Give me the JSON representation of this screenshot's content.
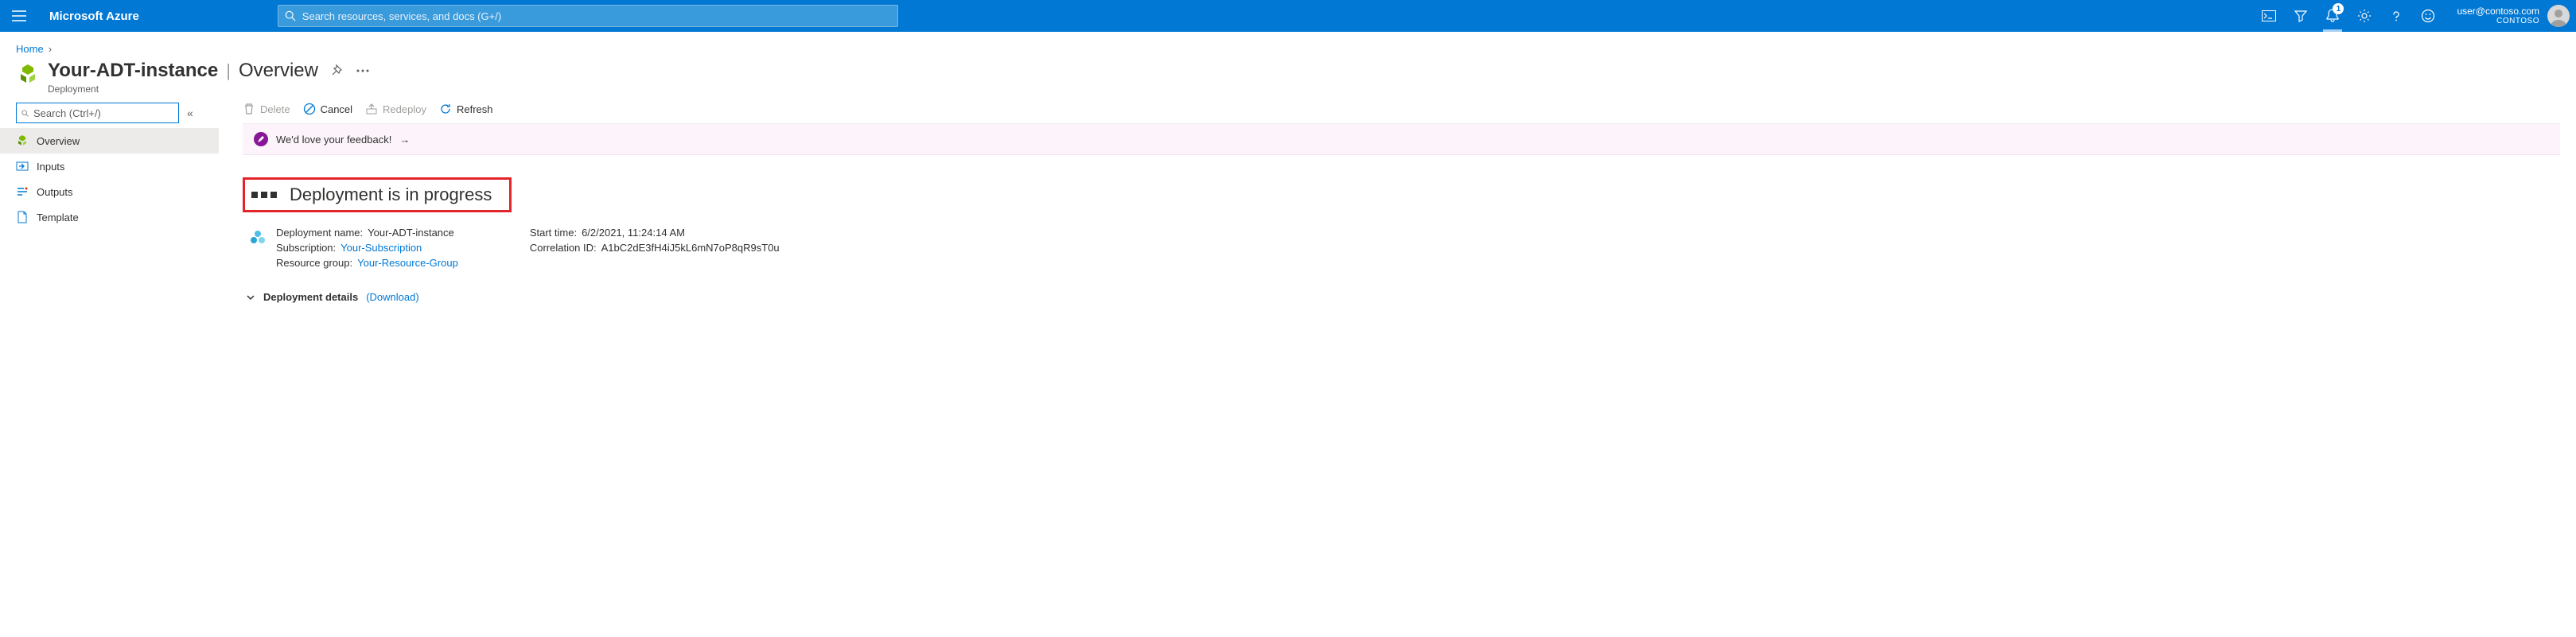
{
  "header": {
    "brand": "Microsoft Azure",
    "search_placeholder": "Search resources, services, and docs (G+/)",
    "notif_count": "1",
    "user_email": "user@contoso.com",
    "user_org": "CONTOSO"
  },
  "breadcrumb": {
    "home": "Home"
  },
  "page": {
    "title": "Your-ADT-instance",
    "section": "Overview",
    "subtitle": "Deployment"
  },
  "sidebar": {
    "search_placeholder": "Search (Ctrl+/)",
    "items": [
      {
        "label": "Overview"
      },
      {
        "label": "Inputs"
      },
      {
        "label": "Outputs"
      },
      {
        "label": "Template"
      }
    ]
  },
  "toolbar": {
    "delete": "Delete",
    "cancel": "Cancel",
    "redeploy": "Redeploy",
    "refresh": "Refresh"
  },
  "feedback": {
    "text": "We'd love your feedback!"
  },
  "status": {
    "title": "Deployment is in progress",
    "deploy_name_label": "Deployment name:",
    "deploy_name_value": "Your-ADT-instance",
    "subscription_label": "Subscription:",
    "subscription_value": "Your-Subscription",
    "rg_label": "Resource group:",
    "rg_value": "Your-Resource-Group",
    "start_label": "Start time:",
    "start_value": "6/2/2021, 11:24:14 AM",
    "corr_label": "Correlation ID:",
    "corr_value": "A1bC2dE3fH4iJ5kL6mN7oP8qR9sT0u"
  },
  "details": {
    "label": "Deployment details",
    "download": "(Download)"
  }
}
